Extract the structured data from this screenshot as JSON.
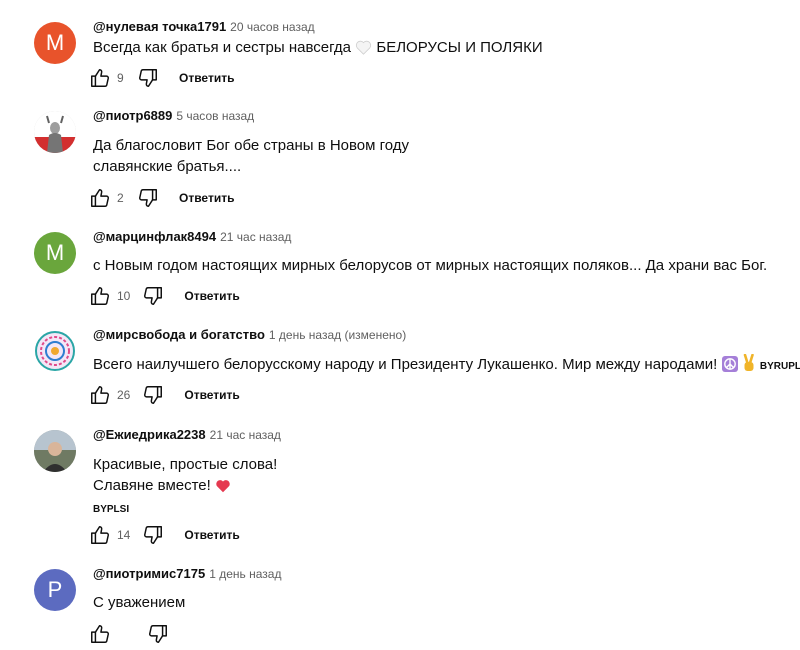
{
  "comments": [
    {
      "avatar_letter": "M",
      "avatar_color": "#e8532b",
      "author": "@нулевая точка1791",
      "time": "20 часов назад",
      "lines": [
        "Всегда как братья и сестры навсегда",
        "БЕЛОРУСЫ И ПОЛЯКИ"
      ],
      "likes": "9",
      "reply_label": "Ответить"
    },
    {
      "avatar_letter": "",
      "avatar_color": "#c9c9c9",
      "author": "@пиотр6889",
      "time": "5 часов назад",
      "lines": [
        "Да благословит Бог обе страны в Новом году",
        "славянские братья...."
      ],
      "likes": "2",
      "reply_label": "Ответить"
    },
    {
      "avatar_letter": "M",
      "avatar_color": "#6aa63c",
      "author": "@марцинфлак8494",
      "time": "21 час назад",
      "lines": [
        "с Новым годом настоящих мирных белорусов от мирных настоящих поляков... Да храни вас Бог."
      ],
      "likes": "10",
      "reply_label": "Ответить"
    },
    {
      "avatar_letter": "",
      "avatar_color": "#ffffff",
      "author": "@мирсвобода и богатство",
      "time": "1 день назад (изменено)",
      "lines": [
        "Всего наилучшего белорусскому народу и Президенту Лукашенко. Мир между народами!"
      ],
      "tag": "BYRUPL",
      "likes": "26",
      "reply_label": "Ответить"
    },
    {
      "avatar_letter": "",
      "avatar_color": "#8a8f86",
      "author": "@Ежиедрика2238",
      "time": "21 час назад",
      "lines": [
        "Красивые, простые слова!",
        "Славяне вместе!"
      ],
      "tag": "BYPLSI",
      "likes": "14",
      "reply_label": "Ответить"
    },
    {
      "avatar_letter": "P",
      "avatar_color": "#5c6bc0",
      "author": "@пиотримис7175",
      "time": "1 день назад",
      "lines": [
        "С уважением"
      ],
      "likes": "",
      "reply_label": ""
    }
  ]
}
